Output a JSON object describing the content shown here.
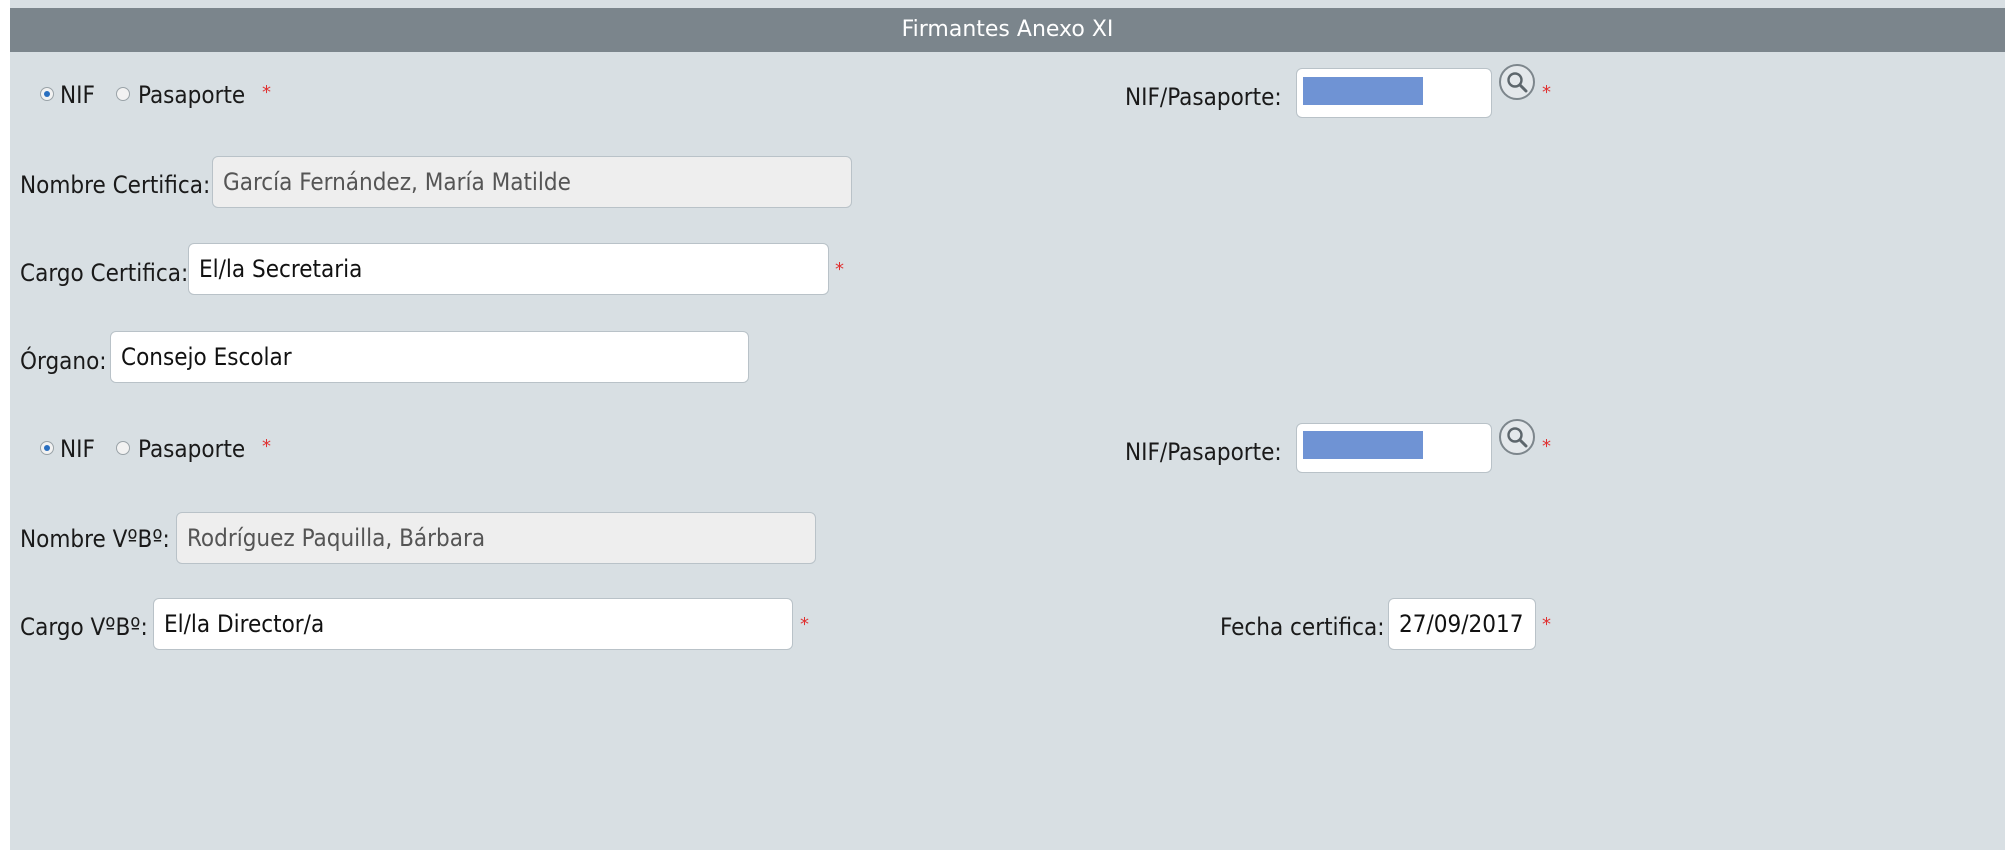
{
  "header": {
    "title": "Firmantes Anexo XI"
  },
  "firmante1": {
    "radio_nif": "NIF",
    "radio_pasaporte": "Pasaporte",
    "nif_label": "NIF/Pasaporte:",
    "nif_value": "",
    "nombre_label": "Nombre Certifica:",
    "nombre_value": "García Fernández, María Matilde",
    "cargo_label": "Cargo Certifica:",
    "cargo_value": "El/la Secretaria",
    "organo_label": "Órgano:",
    "organo_value": "Consejo Escolar"
  },
  "firmante2": {
    "radio_nif": "NIF",
    "radio_pasaporte": "Pasaporte",
    "nif_label": "NIF/Pasaporte:",
    "nif_value": "",
    "nombre_label": "Nombre VºBº:",
    "nombre_value": "Rodríguez Paquilla, Bárbara",
    "cargo_label": "Cargo VºBº:",
    "cargo_value": "El/la Director/a",
    "fecha_label": "Fecha certifica:",
    "fecha_value": "27/09/2017"
  },
  "required_mark": "*",
  "icons": {
    "search": "search-icon"
  },
  "colors": {
    "header": "#7b858c",
    "panel": "#d8dfe3",
    "required": "#e03030",
    "radio_selected": "#2a6fc0"
  }
}
